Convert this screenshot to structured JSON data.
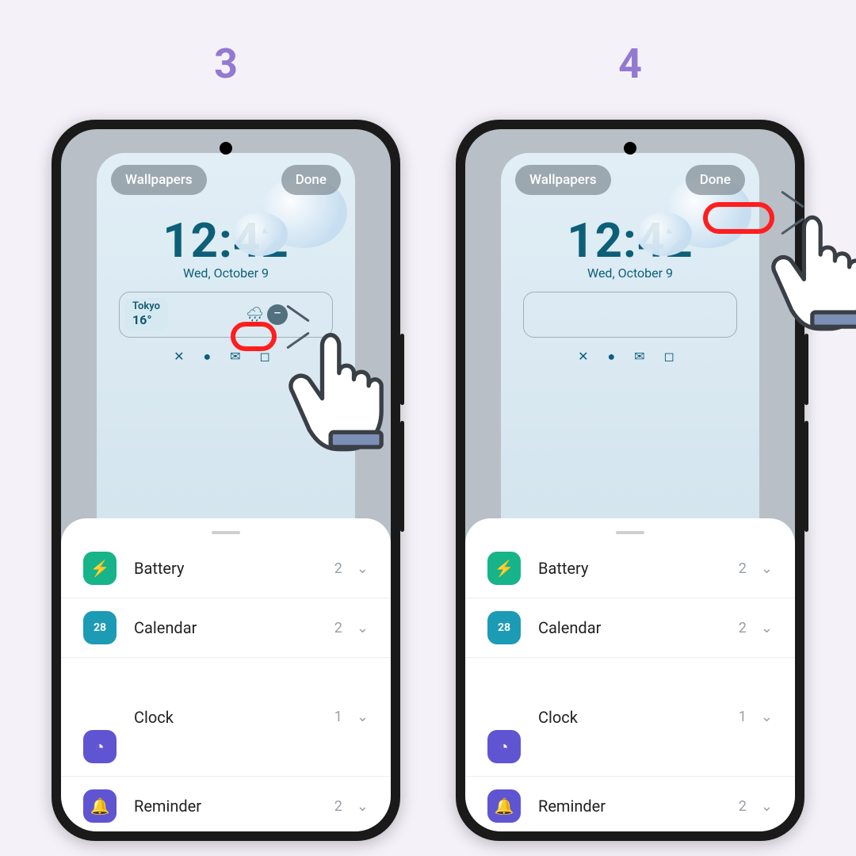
{
  "steps": {
    "left": "3",
    "right": "4"
  },
  "lockscreen": {
    "wallpapers_label": "Wallpapers",
    "done_label": "Done",
    "clock": "12:42",
    "date": "Wed, October 9",
    "weather": {
      "city": "Tokyo",
      "temp": "16°",
      "remove_glyph": "−"
    },
    "icon_strip": "✕ ✉ ◼"
  },
  "notif_icons": {
    "strip": "⌀  ⬤  ✉  ◻"
  },
  "sheet": {
    "items": [
      {
        "name": "Battery",
        "count": "2",
        "icon_class": "battery",
        "glyph": "⚡"
      },
      {
        "name": "Calendar",
        "count": "2",
        "icon_class": "calendar",
        "glyph": "28"
      },
      {
        "name": "Clock",
        "count": "1",
        "icon_class": "clock",
        "glyph": "◔"
      },
      {
        "name": "Reminder",
        "count": "2",
        "icon_class": "reminder",
        "glyph": "🔔"
      }
    ],
    "chevron": "⌄",
    "back_glyph": "‹"
  }
}
